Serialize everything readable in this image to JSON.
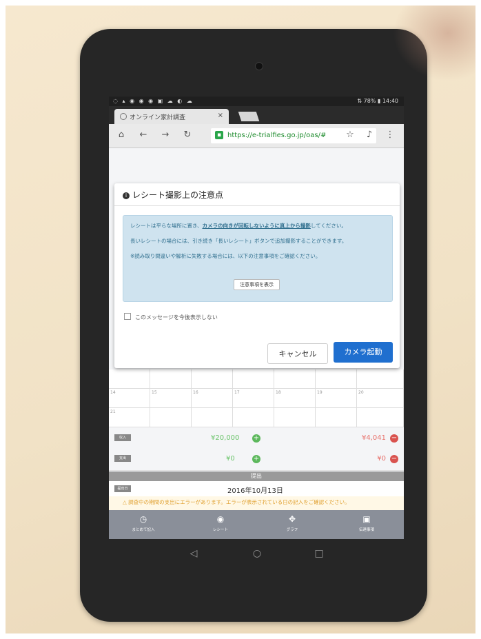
{
  "statusbar": {
    "left_icons": "◌ ▴ ◉ ◉ ◉ ▣ ☁ ◐ ☁",
    "right": "⇅ 78% ▮ 14:40"
  },
  "browser": {
    "tab_title": "オンライン家計調査",
    "tab_close": "×",
    "url": "https://e-trialfies.go.jp/oas/#",
    "icons": [
      "home-icon",
      "back-icon",
      "forward-icon",
      "reload-icon",
      "star-icon",
      "mic-icon",
      "more-icon"
    ]
  },
  "dialog": {
    "title": "レシート撮影上の注意点",
    "info": {
      "line1_a": "レシートは平らな場所に置き、",
      "line1_b": "カメラの向きが回転しないように真上から撮影",
      "line1_c": "してください。",
      "line2": "長いレシートの場合には、引き続き「長いレシート」ボタンで追加撮影することができます。",
      "line3": "※読み取り間違いや解析に失敗する場合には、以下の注意事項をご確認ください。",
      "tips_button": "注意事項を表示"
    },
    "checkbox_label": "このメッセージを今後表示しない",
    "cancel_label": "キャンセル",
    "camera_label": "カメラ起動"
  },
  "calendar": {
    "row1": [
      "",
      "",
      "",
      "",
      "",
      "",
      ""
    ],
    "row2": [
      "14",
      "15",
      "16",
      "17",
      "18",
      "19",
      "20"
    ],
    "row3": [
      "21",
      "",
      "",
      "",
      "",
      "",
      ""
    ]
  },
  "summary": {
    "row1": {
      "tag": "収入",
      "green": "¥20,000",
      "red": "¥4,041"
    },
    "row2": {
      "tag": "支出",
      "green": "¥0",
      "red": "¥0"
    }
  },
  "section_title": "提出",
  "date_row": {
    "tag": "提出日",
    "date": "2016年10月13日"
  },
  "warning": "△ 調査中の期間の支出にエラーがあります。エラーが表示されている日の記入をご確認ください。",
  "bottom_nav": [
    {
      "icon": "◷",
      "label": "まとめて記入"
    },
    {
      "icon": "◉",
      "label": "レシート"
    },
    {
      "icon": "✥",
      "label": "グラフ"
    },
    {
      "icon": "▣",
      "label": "伝達事項"
    }
  ],
  "system_nav": [
    "◁",
    "○",
    "□"
  ]
}
